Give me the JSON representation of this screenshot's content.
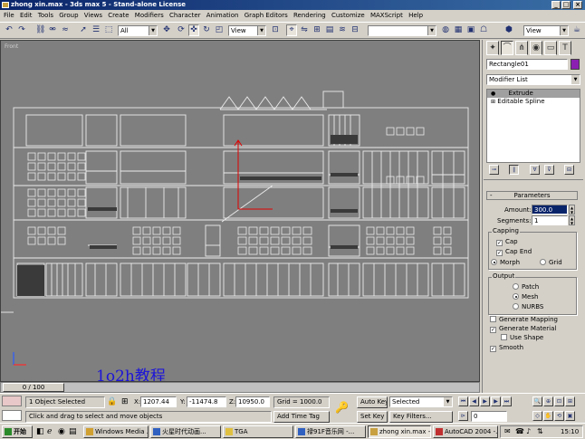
{
  "window": {
    "title": "zhong xin.max - 3ds max 5 - Stand-alone License"
  },
  "menu": [
    "File",
    "Edit",
    "Tools",
    "Group",
    "Views",
    "Create",
    "Modifiers",
    "Character",
    "Animation",
    "Graph Editors",
    "Rendering",
    "Customize",
    "MAXScript",
    "Help"
  ],
  "toolbar": {
    "selection_filter": "All",
    "ref_coord": "View",
    "ref_coord2": "View",
    "named_selection": ""
  },
  "viewport": {
    "label": "Front",
    "watermark": "1o2h教程"
  },
  "timeslider": {
    "label": "0 / 100"
  },
  "command_panel": {
    "object_name": "Rectangle01",
    "object_color": "#8b1fb2",
    "modifier_list": "Modifier List",
    "stack": [
      "Extrude",
      "Editable Spline"
    ],
    "parameters": {
      "title": "Parameters",
      "amount_label": "Amount:",
      "amount": "300.0",
      "segments_label": "Segments:",
      "segments": "1",
      "capping_title": "Capping",
      "cap_start": "Cap",
      "cap_end": "Cap End",
      "morph": "Morph",
      "grid": "Grid",
      "output_title": "Output",
      "patch": "Patch",
      "mesh": "Mesh",
      "nurbs": "NURBS",
      "gen_mapping": "Generate Mapping",
      "gen_material": "Generate Material",
      "use_shape": "Use Shape",
      "smooth": "Smooth"
    }
  },
  "status": {
    "selected": "1 Object Selected",
    "prompt": "Click and drag to select and move objects",
    "x_label": "X:",
    "x": "1207.44",
    "y_label": "Y:",
    "y": "-11474.8",
    "z_label": "Z:",
    "z": "10950.0",
    "grid": "Grid = 1000.0",
    "add_time_tag": "Add Time Tag",
    "auto_key": "Auto Key",
    "set_key": "Set Key",
    "key_mode": "Selected",
    "key_filters": "Key Filters...",
    "frame": "0"
  },
  "taskbar": {
    "start": "开始",
    "tasks": [
      "Windows Media ...",
      "火星时代动画...",
      "TGA",
      "禄91F音乐网 -...",
      "zhong xin.max -...",
      "AutoCAD 2004 -..."
    ],
    "clock": "15:10"
  }
}
